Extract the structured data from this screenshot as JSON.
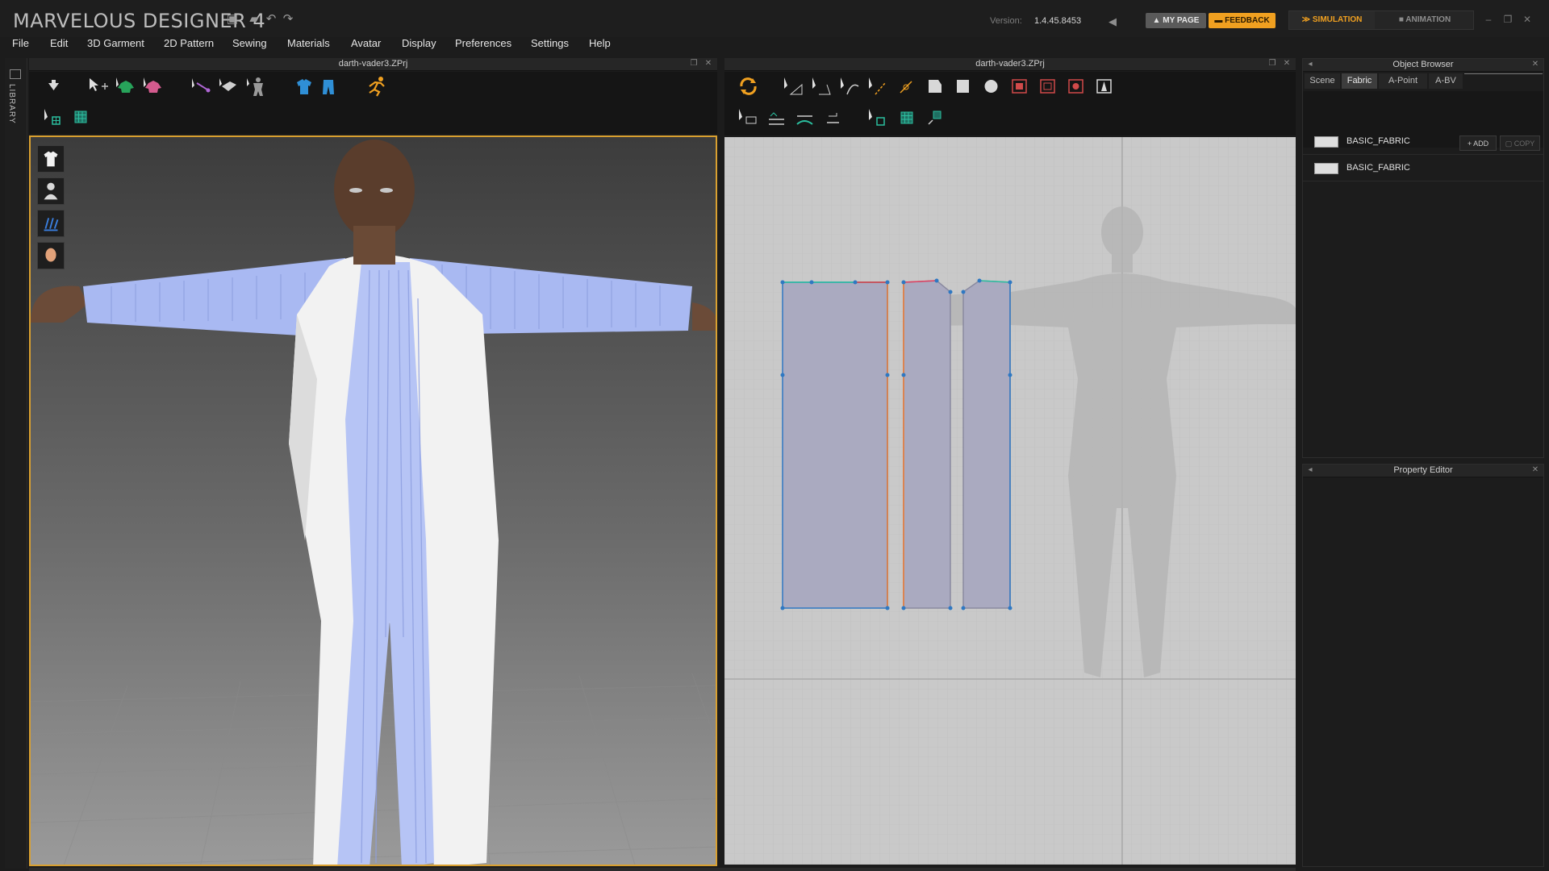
{
  "app": {
    "title": "MARVELOUS DESIGNER 4",
    "version_label": "Version:",
    "version_value": "1.4.45.8453",
    "my_page": "MY PAGE",
    "feedback": "FEEDBACK",
    "tab_simulation": "SIMULATION",
    "tab_animation": "ANIMATION",
    "accent": "#f0a020"
  },
  "menu": [
    "File",
    "Edit",
    "3D Garment",
    "2D Pattern",
    "Sewing",
    "Materials",
    "Avatar",
    "Display",
    "Preferences",
    "Settings",
    "Help"
  ],
  "library": {
    "label": "LIBRARY"
  },
  "view3d": {
    "title": "darth-vader3.ZPrj"
  },
  "view2d": {
    "title": "darth-vader3.ZPrj"
  },
  "object_browser": {
    "title": "Object Browser",
    "tabs": [
      "Scene",
      "Fabric",
      "A-Point",
      "A-BV"
    ],
    "active_tab": "Fabric",
    "add": "ADD",
    "copy": "COPY",
    "fabrics": [
      "BASIC_FABRIC",
      "BASIC_FABRIC"
    ]
  },
  "property_editor": {
    "title": "Property Editor"
  }
}
